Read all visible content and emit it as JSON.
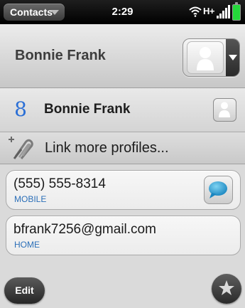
{
  "status_bar": {
    "app_menu_label": "Contacts",
    "time": "2:29",
    "network": "H+",
    "icons": [
      "wifi-icon",
      "signal-icon",
      "battery-icon"
    ]
  },
  "header": {
    "contact_name": "Bonnie Frank",
    "avatar_icon": "person-placeholder-icon"
  },
  "linked_profiles": [
    {
      "service_icon": "google-icon",
      "service_glyph": "8",
      "name": "Bonnie Frank"
    }
  ],
  "link_more": {
    "label": "Link more profiles...",
    "icon": "paperclip-plus-icon"
  },
  "details": {
    "phone": {
      "value": "(555) 555-8314",
      "type": "MOBILE"
    },
    "email": {
      "value": "bfrank7256@gmail.com",
      "type": "HOME"
    }
  },
  "command_bar": {
    "edit_label": "Edit",
    "favorite_icon": "star-icon"
  },
  "colors": {
    "accent_blue": "#2b6fb8",
    "google_blue": "#2b6fd6",
    "battery_green": "#24d83a",
    "sms_teal": "#2a9fd0"
  }
}
